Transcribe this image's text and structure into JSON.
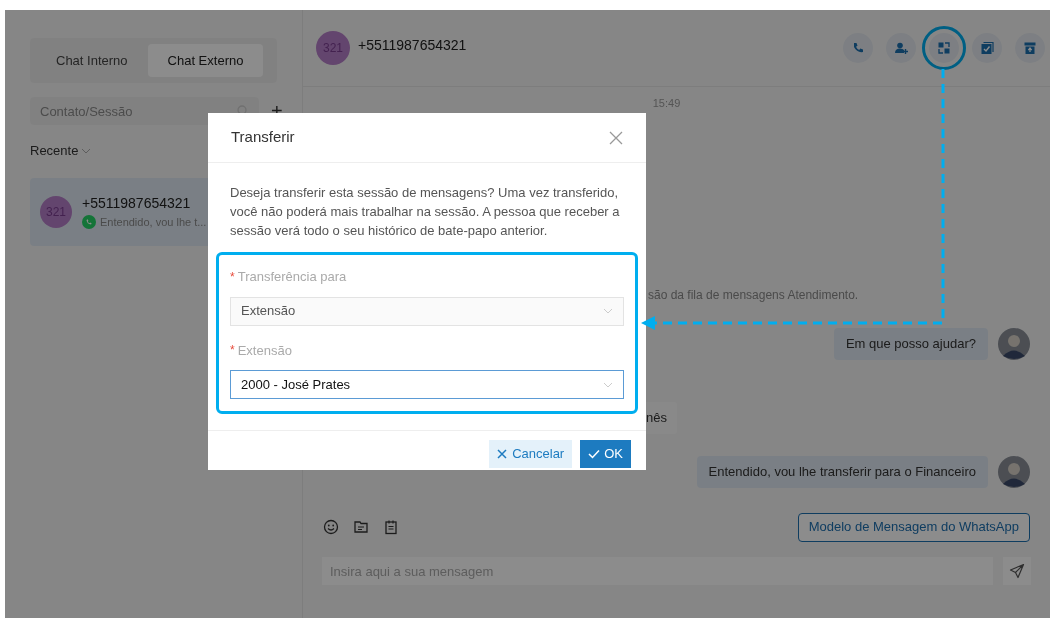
{
  "sidebar": {
    "tabs": [
      {
        "label": "Chat Interno",
        "selected": false
      },
      {
        "label": "Chat Externo",
        "selected": true
      }
    ],
    "search": {
      "placeholder": "Contato/Sessão"
    },
    "add_button": "+",
    "section": "Recente",
    "sessions": [
      {
        "avatar": "321",
        "name": "+5511987654321",
        "preview": "Entendido, vou lhe t...",
        "selected": true
      }
    ]
  },
  "chat": {
    "header": {
      "avatar": "321",
      "title": "+5511987654321"
    },
    "actions": [
      {
        "kind": "phone",
        "highlighted": false
      },
      {
        "kind": "add-user",
        "highlighted": false
      },
      {
        "kind": "transfer",
        "highlighted": true
      },
      {
        "kind": "check",
        "highlighted": false
      },
      {
        "kind": "archive",
        "highlighted": false
      }
    ],
    "messages": [
      {
        "kind": "time",
        "text": "15:49"
      },
      {
        "kind": "system",
        "text": "são da fila de mensagens Atendimento."
      },
      {
        "kind": "outgoing",
        "text": "Em que posso ajudar?"
      },
      {
        "kind": "incoming",
        "text": "nês"
      },
      {
        "kind": "outgoing",
        "text": "Entendido, vou lhe transferir para o Financeiro"
      }
    ],
    "composer": {
      "template_button": "Modelo de Mensagem do WhatsApp",
      "placeholder": "Insira aqui a sua mensagem"
    }
  },
  "dialog": {
    "title": "Transferir",
    "message": "Deseja transferir esta sessão de mensagens? Uma vez transferido, você não poderá mais trabalhar na sessão. A pessoa que receber a sessão verá todo o seu histórico de bate-papo anterior.",
    "fields": [
      {
        "required_mark": "*",
        "label": "Transferência para",
        "value": "Extensão",
        "focused": false
      },
      {
        "required_mark": "*",
        "label": "Extensão",
        "value": "2000 - José Prates",
        "focused": true
      }
    ],
    "buttons": [
      {
        "kind": "cancel",
        "label": "Cancelar"
      },
      {
        "kind": "ok",
        "label": "OK"
      }
    ]
  }
}
